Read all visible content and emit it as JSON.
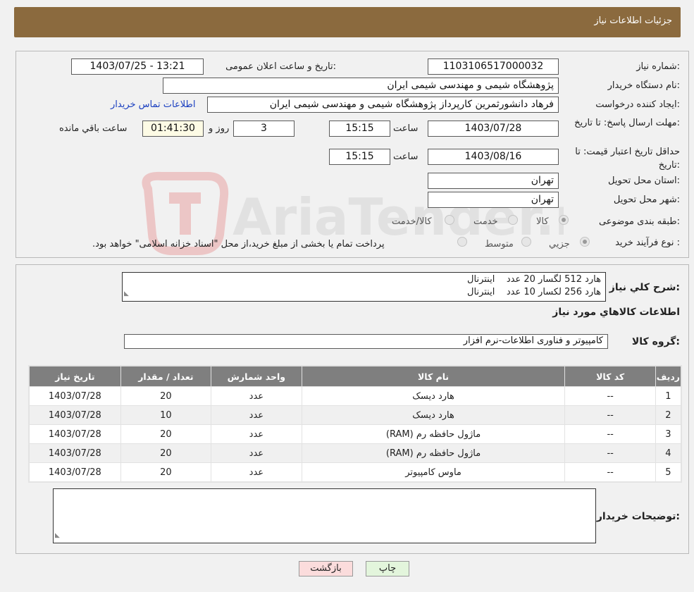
{
  "header": {
    "title": "جزئیات اطلاعات نیاز"
  },
  "watermark": {
    "text": "AriaTender.neT"
  },
  "need": {
    "number_label": "شماره نیاز:",
    "number": "1103106517000032",
    "announce_label": "تاریخ و ساعت اعلان عمومی:",
    "announce": "1403/07/25 - 13:21",
    "buyer_label": "نام دستگاه خریدار:",
    "buyer": "پژوهشگاه شیمی و مهندسی شیمی ایران",
    "creator_label": "ایجاد کننده درخواست:",
    "creator": "فرهاد دانشورثمرین کارپرداز پژوهشگاه شیمی و مهندسی شیمی ایران",
    "contact_link": "اطلاعات تماس خریدار",
    "deadline_label": "مهلت ارسال پاسخ: تا تاریخ:",
    "deadline_date": "1403/07/28",
    "time_label": "ساعت",
    "deadline_time": "15:15",
    "days": "3",
    "days_label": "روز و",
    "remaining": "01:41:30",
    "remaining_label": "ساعت باقي مانده",
    "validity_label": "حداقل تاریخ اعتبار قیمت: تا تاریخ:",
    "validity_date": "1403/08/16",
    "validity_time": "15:15",
    "province_label": "استان محل تحویل:",
    "province": "تهران",
    "city_label": "شهر محل تحویل:",
    "city": "تهران",
    "category_label": "طبقه بندی موضوعی:",
    "category_options": [
      "کالا",
      "خدمت",
      "کالا/خدمت"
    ],
    "process_label": "نوع فرآیند خرید :",
    "process_options": [
      "جزیي",
      "متوسط"
    ],
    "process_note": "پرداخت تمام یا بخشی از مبلغ خرید،از محل \"اسناد خزانه اسلامی\" خواهد بود."
  },
  "details": {
    "summary_label": "شرح کلي نیاز:",
    "summary_lines": [
      "هارد 512 لگسار 20 عدد    اینترنال",
      "هارد 256 لکسار 10 عدد    اینترنال"
    ],
    "goods_title": "اطلاعات کالاهاي مورد نیاز",
    "group_label": "گروه کالا:",
    "group": "کامپیوتر و فناوری اطلاعات-نرم افزار",
    "table": {
      "headers": [
        "ردیف",
        "کد کالا",
        "نام کالا",
        "واحد شمارش",
        "تعداد / مقدار",
        "تاریخ نیاز"
      ],
      "rows": [
        [
          "1",
          "--",
          "هارد دیسک",
          "عدد",
          "20",
          "1403/07/28"
        ],
        [
          "2",
          "--",
          "هارد دیسک",
          "عدد",
          "10",
          "1403/07/28"
        ],
        [
          "3",
          "--",
          "ماژول حافظه رم (RAM)",
          "عدد",
          "20",
          "1403/07/28"
        ],
        [
          "4",
          "--",
          "ماژول حافظه رم (RAM)",
          "عدد",
          "20",
          "1403/07/28"
        ],
        [
          "5",
          "--",
          "ماوس کامپیوتر",
          "عدد",
          "20",
          "1403/07/28"
        ]
      ]
    },
    "buyer_notes_label": "توضیحات خریدار:",
    "buyer_notes": ""
  },
  "buttons": {
    "print": "چاپ",
    "back": "بازگشت"
  },
  "colors": {
    "header": "#8b6a3e",
    "table_header": "#7f7f7f",
    "back_button": "#fbdcdc",
    "print_button": "#e3f5dc"
  }
}
